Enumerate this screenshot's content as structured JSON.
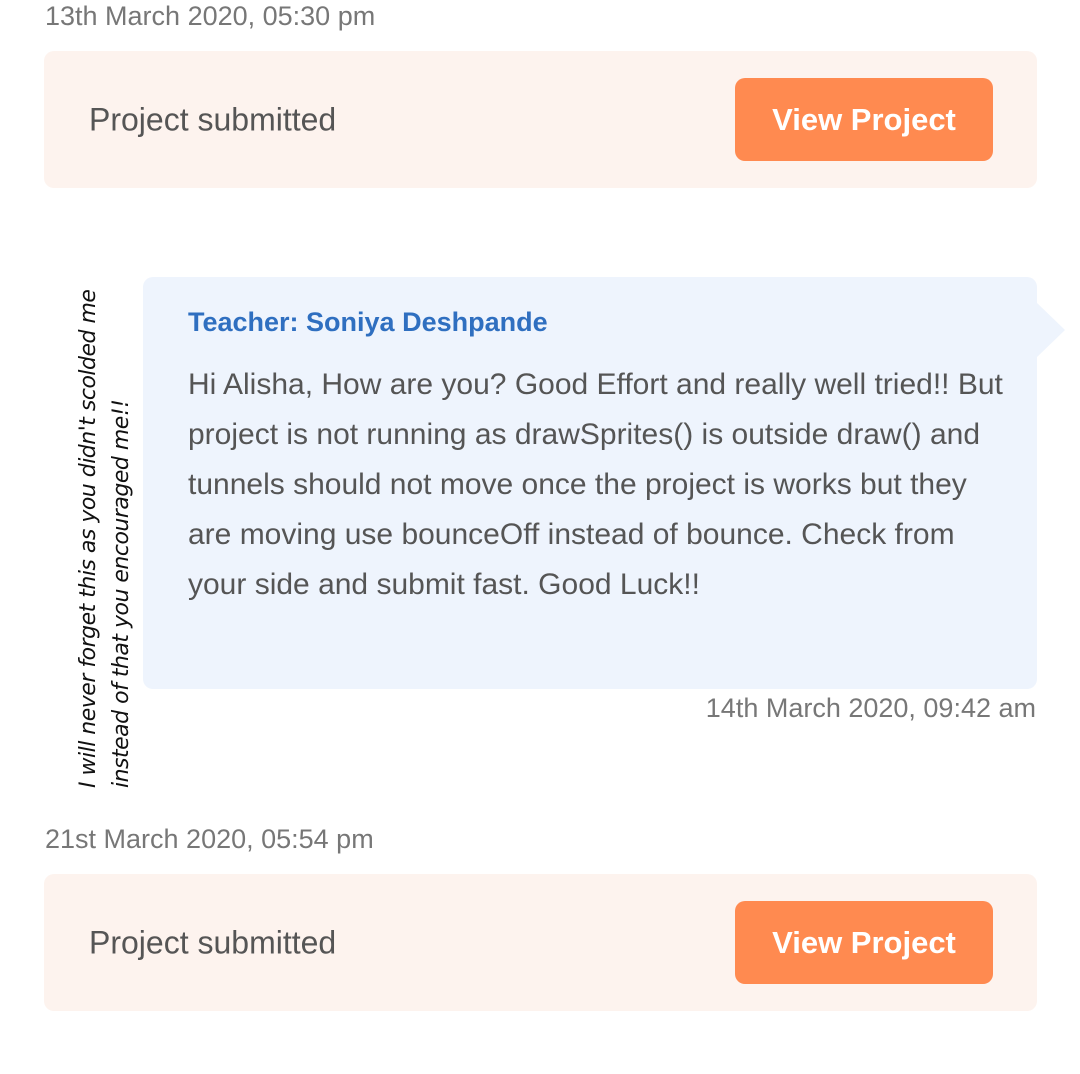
{
  "entries": [
    {
      "timestamp": "13th March 2020, 05:30 pm",
      "status": "Project submitted",
      "button_label": "View Project"
    },
    {
      "teacher": "Teacher: Soniya Deshpande",
      "message": "Hi Alisha, How are you? Good Effort and really well tried!! But project is not running as drawSprites() is outside draw() and tunnels should not move once the project is works but they are moving use bounceOff instead of bounce. Check from your side and submit fast. Good Luck!!",
      "timestamp": "14th March 2020, 09:42 am"
    },
    {
      "timestamp": "21st March 2020, 05:54 pm",
      "status": "Project submitted",
      "button_label": "View Project"
    }
  ],
  "handwritten_note": "I will never forget this as you didn't scolded me instead of that you encouraged me!!",
  "colors": {
    "accent_button": "#ff8a50",
    "teacher_name": "#2f6fc0",
    "submit_card_bg": "#fdf3ee",
    "message_bubble_bg": "#eef4fd"
  }
}
